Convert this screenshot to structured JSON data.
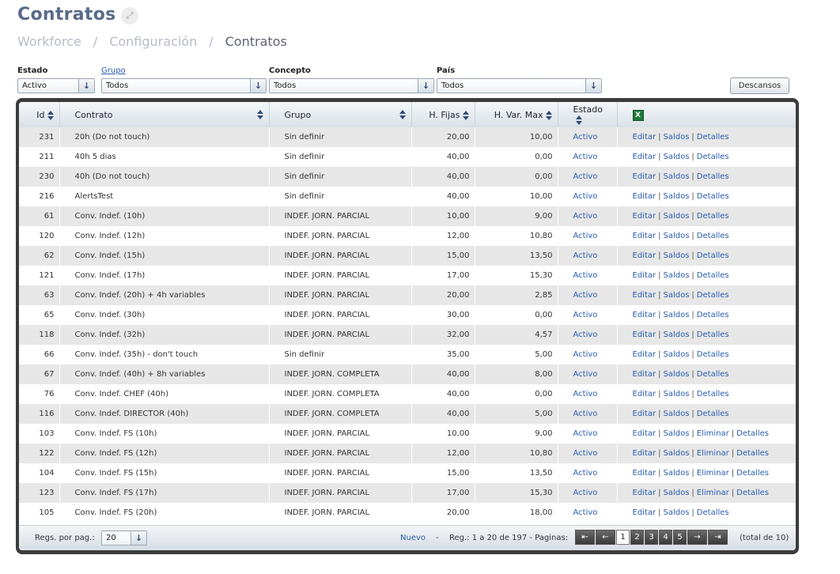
{
  "page": {
    "title": "Contratos",
    "breadcrumb": [
      "Workforce",
      "Configuración",
      "Contratos"
    ]
  },
  "filters": {
    "estado": {
      "label": "Estado",
      "value": "Activo"
    },
    "grupo": {
      "label": "Grupo",
      "value": "Todos"
    },
    "concepto": {
      "label": "Concepto",
      "value": "Todos"
    },
    "pais": {
      "label": "País",
      "value": "Todos"
    },
    "descansos_label": "Descansos"
  },
  "table": {
    "headers": {
      "id": "Id",
      "contrato": "Contrato",
      "grupo": "Grupo",
      "hfijas": "H. Fijas",
      "hvar": "H. Var. Max",
      "estado": "Estado"
    },
    "action_labels": {
      "editar": "Editar",
      "saldos": "Saldos",
      "eliminar": "Eliminar",
      "detalles": "Detalles"
    },
    "rows": [
      {
        "id": "231",
        "contrato": "20h (Do not touch)",
        "grupo": "Sin definir",
        "hfijas": "20,00",
        "hvar": "10,00",
        "estado": "Activo",
        "eliminar": false
      },
      {
        "id": "211",
        "contrato": "40h 5 dias",
        "grupo": "Sin definir",
        "hfijas": "40,00",
        "hvar": "0,00",
        "estado": "Activo",
        "eliminar": false
      },
      {
        "id": "230",
        "contrato": "40h (Do not touch)",
        "grupo": "Sin definir",
        "hfijas": "40,00",
        "hvar": "0,00",
        "estado": "Activo",
        "eliminar": false
      },
      {
        "id": "216",
        "contrato": "AlertsTest",
        "grupo": "Sin definir",
        "hfijas": "40,00",
        "hvar": "10,00",
        "estado": "Activo",
        "eliminar": false
      },
      {
        "id": "61",
        "contrato": "Conv. Indef. (10h)",
        "grupo": "INDEF. JORN. PARCIAL",
        "hfijas": "10,00",
        "hvar": "9,00",
        "estado": "Activo",
        "eliminar": false
      },
      {
        "id": "120",
        "contrato": "Conv. Indef. (12h)",
        "grupo": "INDEF. JORN. PARCIAL",
        "hfijas": "12,00",
        "hvar": "10,80",
        "estado": "Activo",
        "eliminar": false
      },
      {
        "id": "62",
        "contrato": "Conv. Indef. (15h)",
        "grupo": "INDEF. JORN. PARCIAL",
        "hfijas": "15,00",
        "hvar": "13,50",
        "estado": "Activo",
        "eliminar": false
      },
      {
        "id": "121",
        "contrato": "Conv. Indef. (17h)",
        "grupo": "INDEF. JORN. PARCIAL",
        "hfijas": "17,00",
        "hvar": "15,30",
        "estado": "Activo",
        "eliminar": false
      },
      {
        "id": "63",
        "contrato": "Conv. Indef. (20h) + 4h variables",
        "grupo": "INDEF. JORN. PARCIAL",
        "hfijas": "20,00",
        "hvar": "2,85",
        "estado": "Activo",
        "eliminar": false
      },
      {
        "id": "65",
        "contrato": "Conv. Indef. (30h)",
        "grupo": "INDEF. JORN. PARCIAL",
        "hfijas": "30,00",
        "hvar": "0,00",
        "estado": "Activo",
        "eliminar": false
      },
      {
        "id": "118",
        "contrato": "Conv. Indef. (32h)",
        "grupo": "INDEF. JORN. PARCIAL",
        "hfijas": "32,00",
        "hvar": "4,57",
        "estado": "Activo",
        "eliminar": false
      },
      {
        "id": "66",
        "contrato": "Conv. Indef. (35h) - don't touch",
        "grupo": "Sin definir",
        "hfijas": "35,00",
        "hvar": "5,00",
        "estado": "Activo",
        "eliminar": false
      },
      {
        "id": "67",
        "contrato": "Conv. Indef. (40h) + 8h variables",
        "grupo": "INDEF. JORN. COMPLETA",
        "hfijas": "40,00",
        "hvar": "8,00",
        "estado": "Activo",
        "eliminar": false
      },
      {
        "id": "76",
        "contrato": "Conv. Indef. CHEF (40h)",
        "grupo": "INDEF. JORN. COMPLETA",
        "hfijas": "40,00",
        "hvar": "0,00",
        "estado": "Activo",
        "eliminar": false
      },
      {
        "id": "116",
        "contrato": "Conv. Indef. DIRECTOR (40h)",
        "grupo": "INDEF. JORN. COMPLETA",
        "hfijas": "40,00",
        "hvar": "5,00",
        "estado": "Activo",
        "eliminar": false
      },
      {
        "id": "103",
        "contrato": "Conv. Indef. FS (10h)",
        "grupo": "INDEF. JORN. PARCIAL",
        "hfijas": "10,00",
        "hvar": "9,00",
        "estado": "Activo",
        "eliminar": true
      },
      {
        "id": "122",
        "contrato": "Conv. Indef. FS (12h)",
        "grupo": "INDEF. JORN. PARCIAL",
        "hfijas": "12,00",
        "hvar": "10,80",
        "estado": "Activo",
        "eliminar": true
      },
      {
        "id": "104",
        "contrato": "Conv. Indef. FS (15h)",
        "grupo": "INDEF. JORN. PARCIAL",
        "hfijas": "15,00",
        "hvar": "13,50",
        "estado": "Activo",
        "eliminar": true
      },
      {
        "id": "123",
        "contrato": "Conv. Indef. FS (17h)",
        "grupo": "INDEF. JORN. PARCIAL",
        "hfijas": "17,00",
        "hvar": "15,30",
        "estado": "Activo",
        "eliminar": true
      },
      {
        "id": "105",
        "contrato": "Conv. Indef. FS (20h)",
        "grupo": "INDEF. JORN. PARCIAL",
        "hfijas": "20,00",
        "hvar": "18,00",
        "estado": "Activo",
        "eliminar": false
      }
    ]
  },
  "pager": {
    "per_page_label": "Regs. por pag.:",
    "per_page_value": "20",
    "nuevo_label": "Nuevo",
    "separator": "-",
    "regs_text": "Reg.: 1 a 20 de 197 - Paginas:",
    "pages": [
      "1",
      "2",
      "3",
      "4",
      "5"
    ],
    "current_page": "1",
    "total_text": "(total de 10)"
  },
  "icons": {
    "expand": "expand-icon",
    "dropdown": "arrow-down-icon",
    "sort": "sort-icon",
    "excel": "excel-icon",
    "first": "first-page-icon",
    "prev": "prev-page-icon",
    "next": "next-page-icon",
    "last": "last-page-icon"
  }
}
